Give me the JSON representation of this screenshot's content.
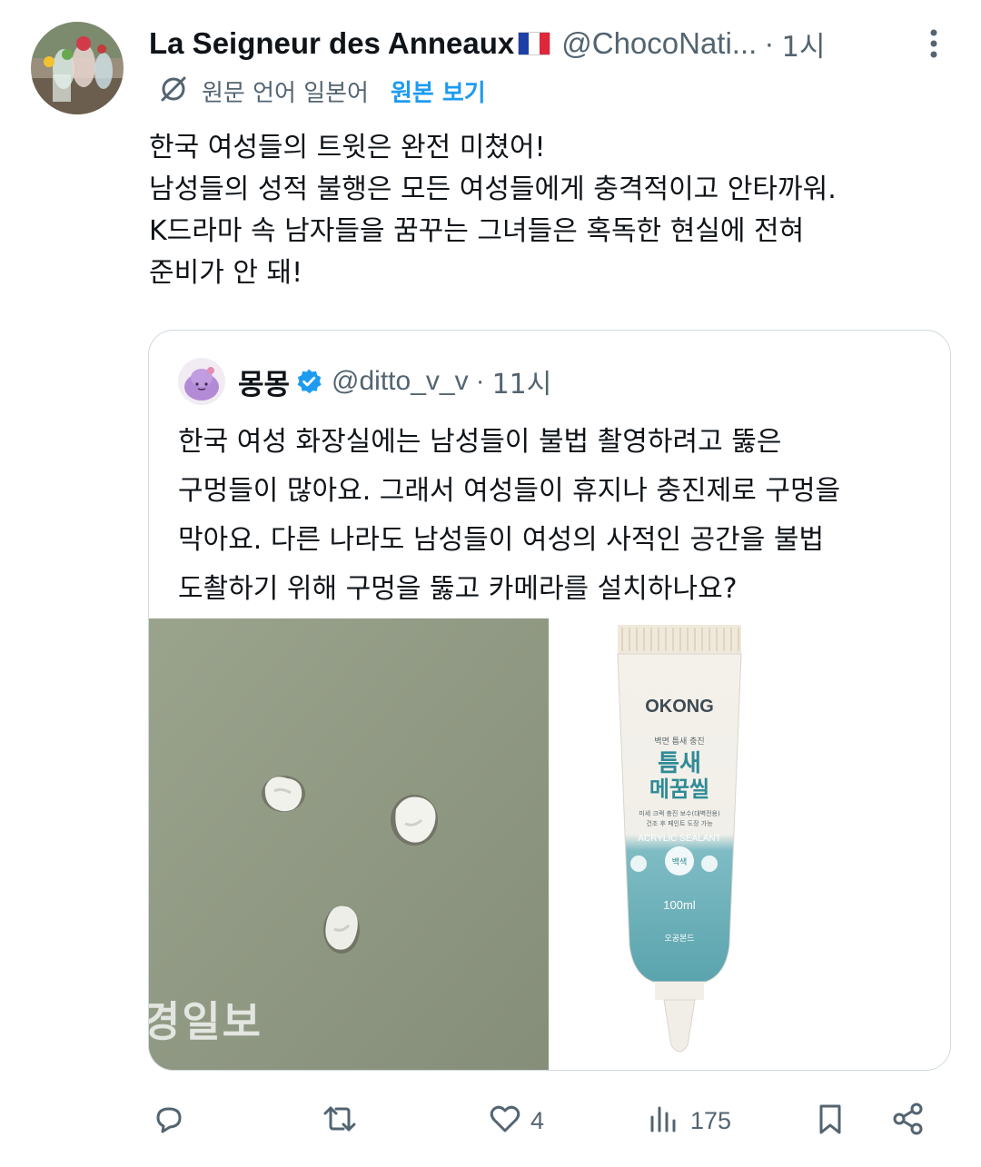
{
  "tweet": {
    "display_name": "La Seigneur des Anneaux",
    "handle": "@ChocoNati...",
    "dot": "·",
    "time": "1시",
    "translate": {
      "original_language": "원문 언어 일본어",
      "show_original": "원본 보기"
    },
    "text": "한국 여성들의 트윗은 완전 미쳤어!\n남성들의 성적 불행은 모든 여성들에게 충격적이고 안타까워.\nK드라마 속 남자들을 꿈꾸는 그녀들은 혹독한 현실에 전혀\n준비가 안 돼!",
    "icons": {
      "more": "more-dots-icon",
      "translate": "translate-icon",
      "flag": "france-flag-icon"
    }
  },
  "quote": {
    "display_name": "몽몽",
    "handle": "@ditto_v_v",
    "dot": "·",
    "time": "11시",
    "text": "한국 여성 화장실에는 남성들이 불법 촬영하려고 뚫은\n구멍들이 많아요. 그래서 여성들이 휴지나 충진제로 구멍을\n막아요. 다른 나라도 남성들이 여성의 사적인 공간을 불법\n도촬하기 위해 구멍을 뚫고 카메라를 설치하나요?",
    "media": {
      "left_watermark": "경일보",
      "product": {
        "brand": "OKONG",
        "small_text": "벽면 틈새 충진",
        "title_line1": "틈새",
        "title_line2": "메꿈씰",
        "desc_line1": "미세 크랙 충진 보수(대벽전용)",
        "desc_line2": "건조 후 페인트 도장 가능",
        "sealant": "ACRYLIC SEALANT",
        "color_badge": "백색",
        "volume": "100ml",
        "maker": "오공본드"
      }
    }
  },
  "actions": {
    "reply_count": "",
    "retweet_count": "",
    "like_count": "4",
    "views_count": "175"
  },
  "colors": {
    "text": "#0f1419",
    "secondary": "#536471",
    "link": "#1d9bf0",
    "border": "#cfd9de",
    "verified": "#1d9bf0"
  }
}
